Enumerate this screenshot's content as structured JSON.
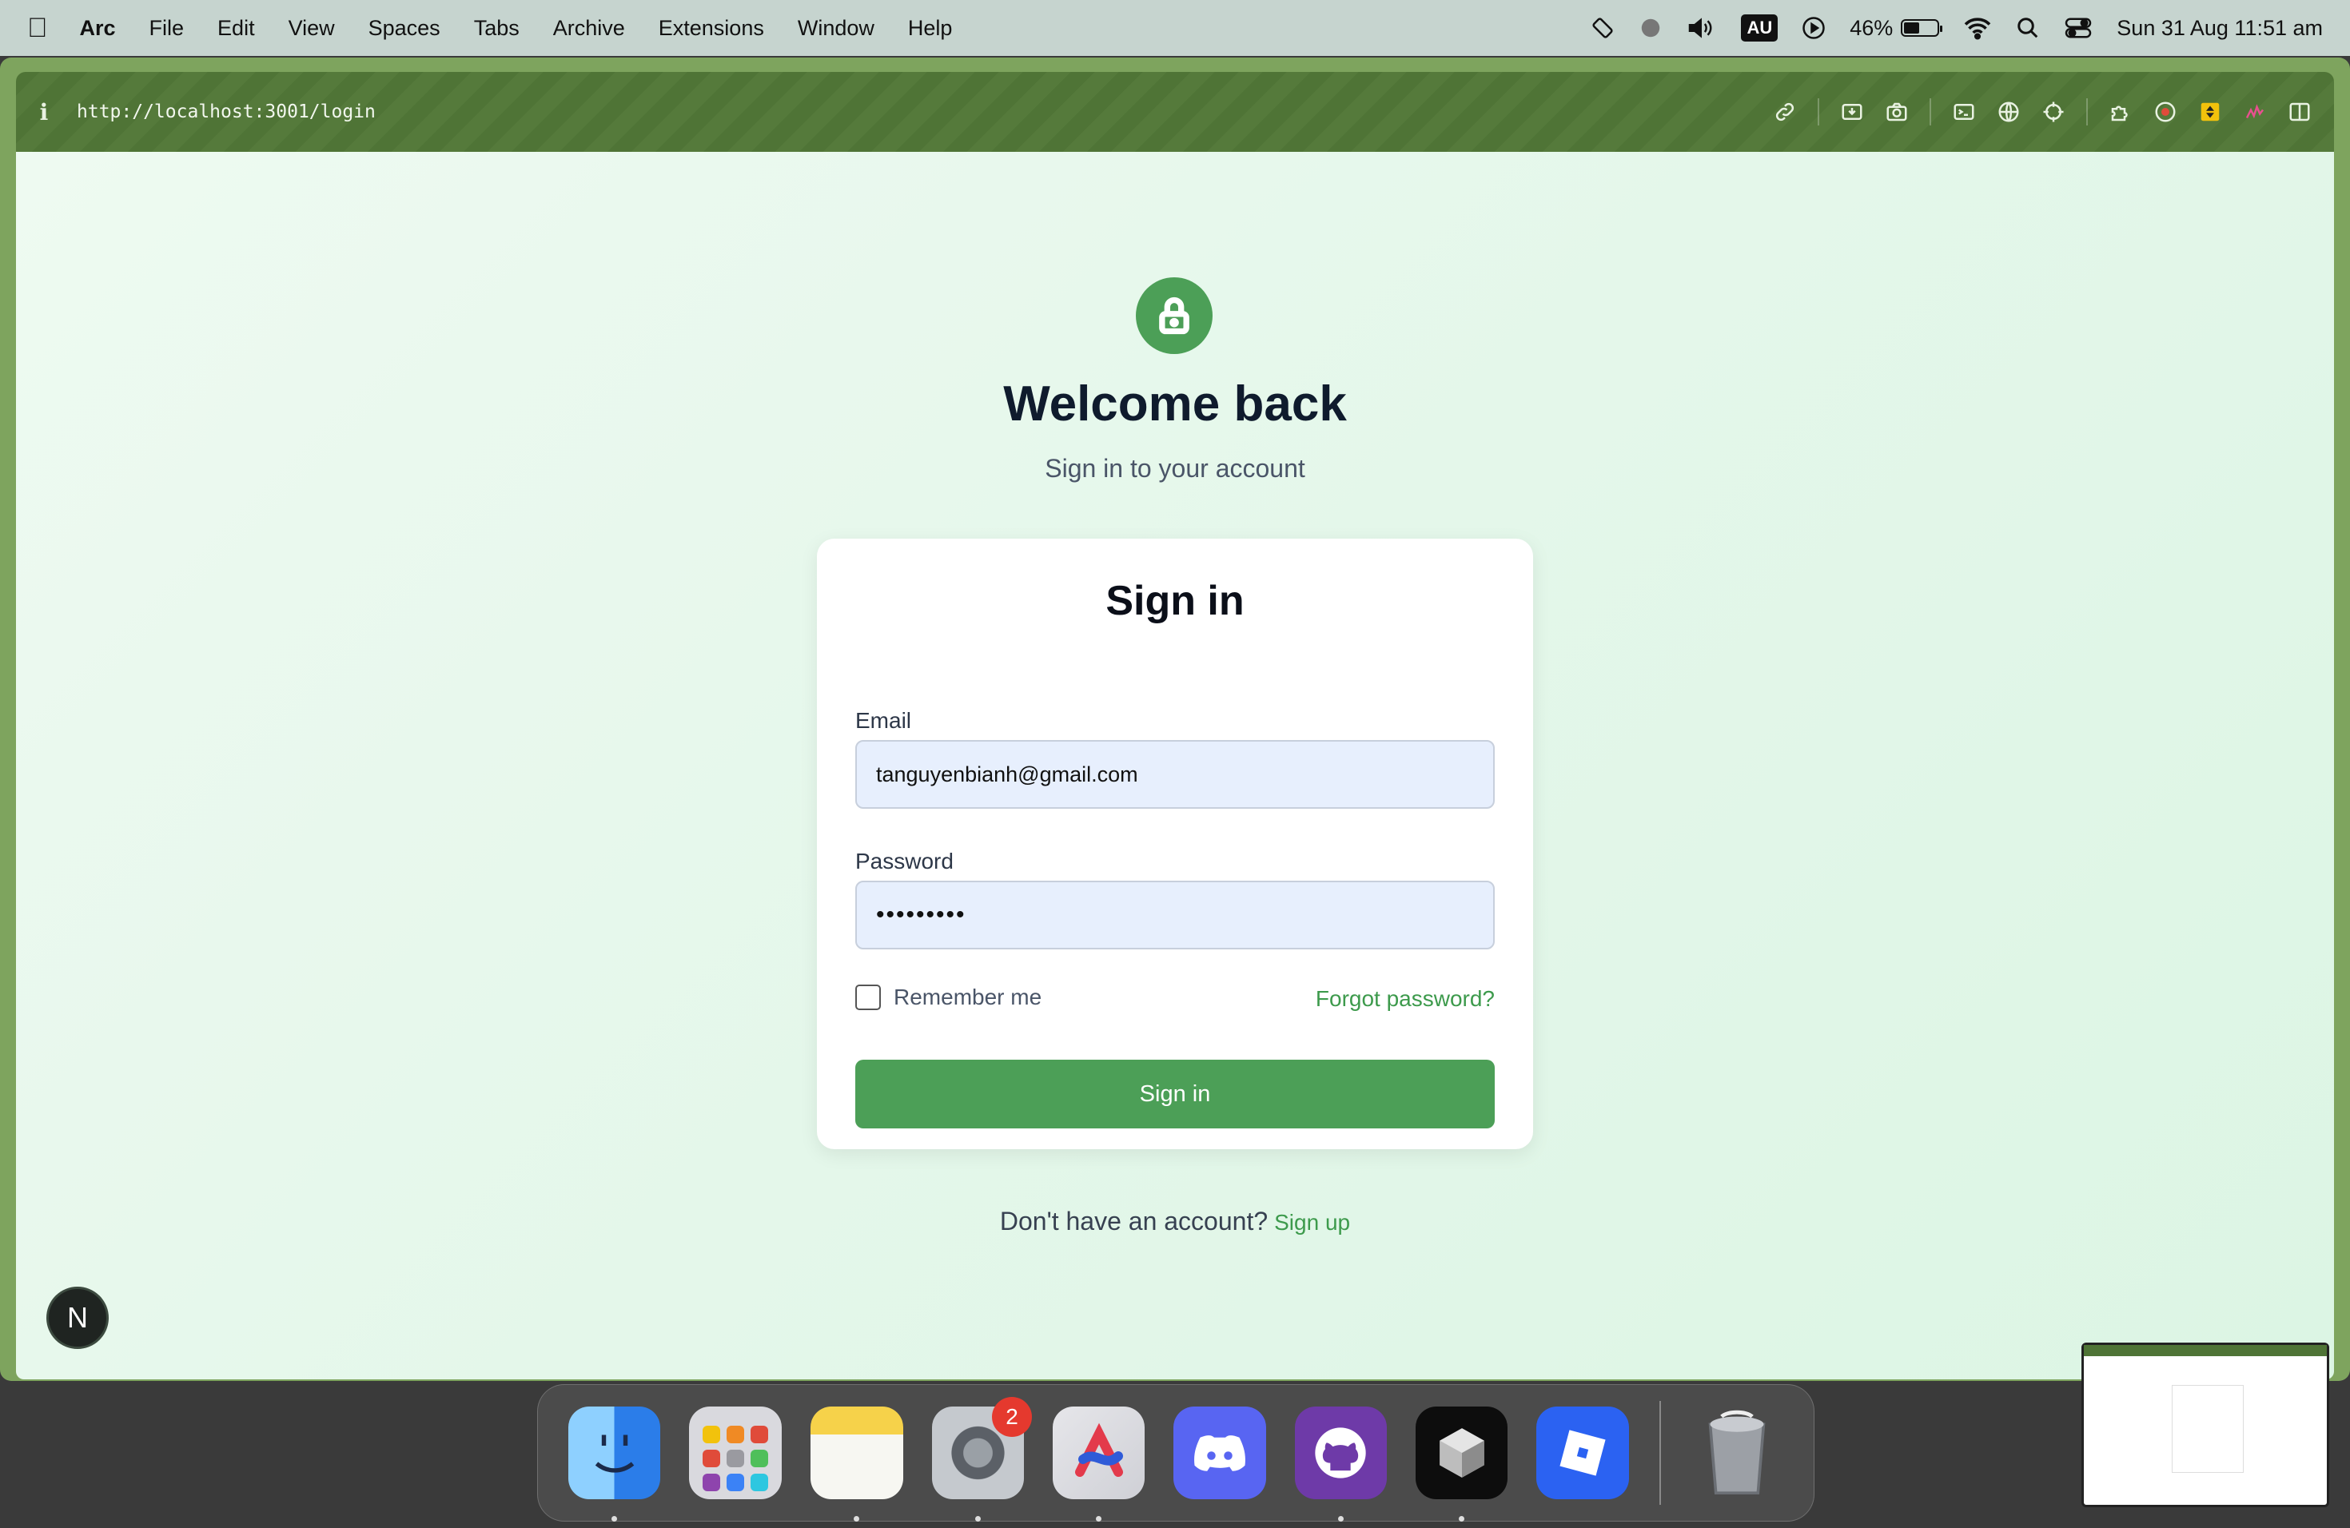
{
  "menubar": {
    "app": "Arc",
    "menus": [
      "File",
      "Edit",
      "View",
      "Spaces",
      "Tabs",
      "Archive",
      "Extensions",
      "Window",
      "Help"
    ],
    "input_source": "AU",
    "battery": "46%",
    "battery_level": 0.46,
    "datetime": "Sun 31 Aug  11:51 am"
  },
  "browser": {
    "url": "http://localhost:3001/login",
    "info_icon": "i"
  },
  "page": {
    "title": "Welcome back",
    "subtitle": "Sign in to your account",
    "card": {
      "title": "Sign in",
      "email_label": "Email",
      "email_value": "tanguyenbianh@gmail.com",
      "password_label": "Password",
      "password_value": "•••••••••",
      "remember_label": "Remember me",
      "forgot_label": "Forgot password?",
      "submit_label": "Sign in"
    },
    "signup_prompt": "Don't have an account?",
    "signup_link": "Sign up",
    "next_badge": "N"
  },
  "dock": {
    "settings_badge": "2"
  },
  "colors": {
    "accent": "#4c9f57",
    "link": "#3d9a4c",
    "frame": "#7ea45e"
  }
}
